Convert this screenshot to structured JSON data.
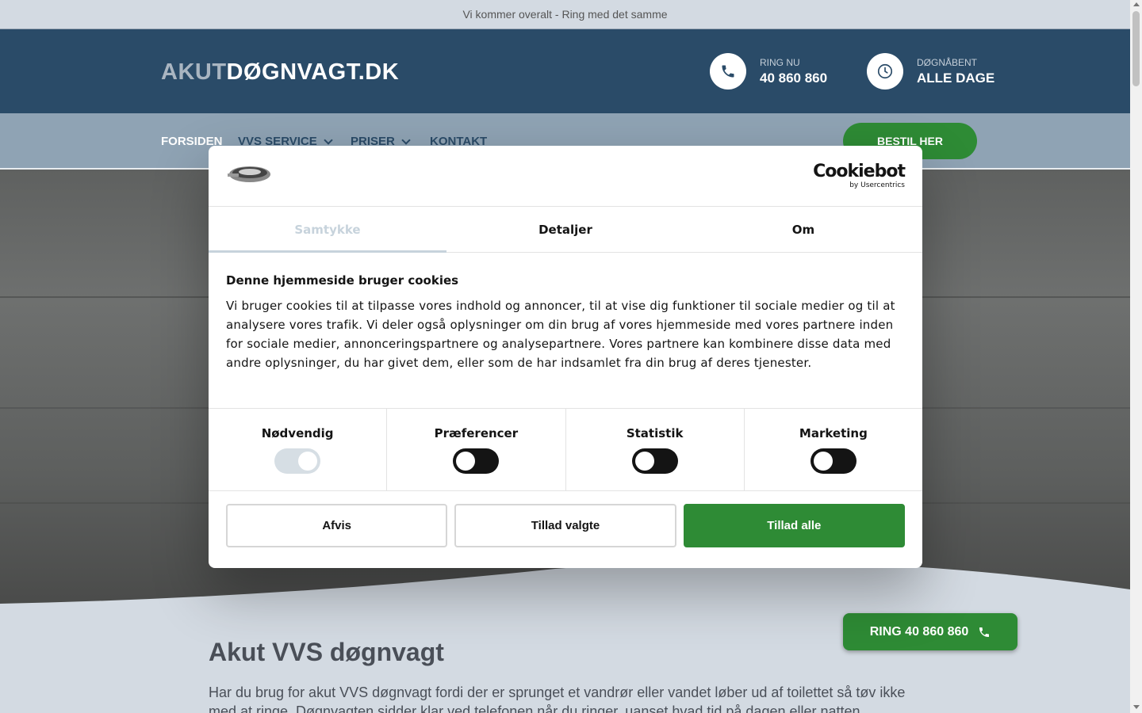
{
  "topbar": {
    "text": "Vi kommer overalt - Ring med det samme"
  },
  "header": {
    "logo_dim": "AKUT",
    "logo_bright": "DØGNVAGT.DK",
    "phone_label": "RING NU",
    "phone_value": "40 860 860",
    "hours_label": "DØGNÅBENT",
    "hours_value": "ALLE DAGE",
    "icons": [
      "phone-icon",
      "clock-icon"
    ]
  },
  "nav": {
    "items": [
      {
        "label": "FORSIDEN"
      },
      {
        "label": "VVS SERVICE"
      },
      {
        "label": "PRISER"
      },
      {
        "label": "KONTAKT"
      }
    ],
    "cta": "BESTIL HER"
  },
  "content": {
    "title": "Akut VVS døgnvagt",
    "text": "Har du brug for akut VVS døgnvagt fordi der er sprunget et vandrør eller vandet løber ud af toilettet så tøv ikke med at ringe. Døgnvagten sidder klar ved telefonen når du ringer, uanset hvad tid på dagen eller natten",
    "ring_button": "RING 40 860 860"
  },
  "cookie_dialog": {
    "brand": "Cookiebot",
    "brand_by": "by Usercentrics",
    "tabs": [
      {
        "label": "Samtykke"
      },
      {
        "label": "Detaljer"
      },
      {
        "label": "Om"
      }
    ],
    "title": "Denne hjemmeside bruger cookies",
    "text": "Vi bruger cookies til at tilpasse vores indhold og annoncer, til at vise dig funktioner til sociale medier og til at analysere vores trafik. Vi deler også oplysninger om din brug af vores hjemmeside med vores partnere inden for sociale medier, annonceringspartnere og analysepartnere. Vores partnere kan kombinere disse data med andre oplysninger, du har givet dem, eller som de har indsamlet fra din brug af deres tjenester.",
    "toggles": [
      {
        "label": "Nødvendig",
        "state": "on-disabled"
      },
      {
        "label": "Præferencer",
        "state": "off"
      },
      {
        "label": "Statistik",
        "state": "off"
      },
      {
        "label": "Marketing",
        "state": "off"
      }
    ],
    "buttons": {
      "deny": "Afvis",
      "allow_selected": "Tillad valgte",
      "allow_all": "Tillad alle"
    }
  },
  "colors": {
    "header_bg": "#2a4b68",
    "nav_bg": "#8fa3b4",
    "accent_green": "#2e8b35",
    "page_bg": "#d3dae2"
  }
}
